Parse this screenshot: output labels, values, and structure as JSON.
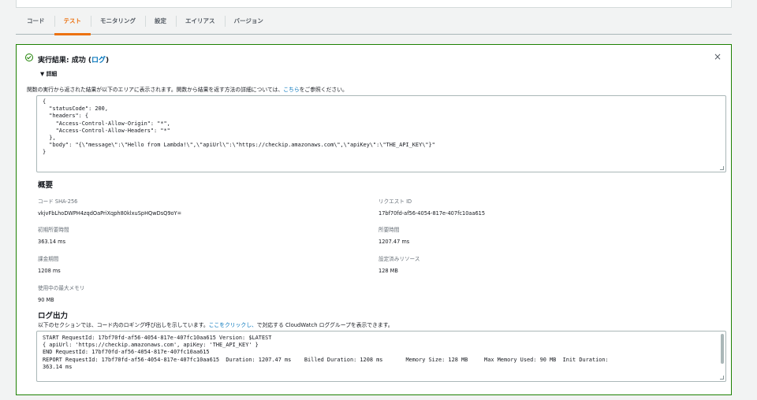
{
  "tabs": [
    "コード",
    "テスト",
    "モニタリング",
    "設定",
    "エイリアス",
    "バージョン"
  ],
  "result": {
    "title_prefix": "実行結果: 成功 (",
    "title_link": "ログ",
    "title_suffix": ")",
    "close": "×",
    "details_label": "▼ 詳細",
    "description_prefix": "関数の実行から返された結果が以下のエリアに表示されます。関数から結果を返す方法の詳細については、",
    "description_link": "こちら",
    "description_suffix": "をご参照ください。",
    "output": "{\n  \"statusCode\": 200,\n  \"headers\": {\n    \"Access-Control-Allow-Origin\": \"*\",\n    \"Access-Control-Allow-Headers\": \"*\"\n  },\n  \"body\": \"{\\\"message\\\":\\\"Hello from Lambda!\\\",\\\"apiUrl\\\":\\\"https://checkip.amazonaws.com\\\",\\\"apiKey\\\":\\\"THE_API_KEY\\\"}\"\n}"
  },
  "summary": {
    "heading": "概要",
    "code_sha_label": "コード SHA-256",
    "code_sha_value": "vkjvFbLhoDWPH4zqdOaPriXqph80klxuSpHQwDsQ9oY=",
    "request_id_label": "リクエスト ID",
    "request_id_value": "17bf70fd-af56-4054-817e-407fc10aa615",
    "init_duration_label": "初期所要時間",
    "init_duration_value": "363.14 ms",
    "duration_label": "所要時間",
    "duration_value": "1207.47 ms",
    "billed_label": "課金期間",
    "billed_value": "1208 ms",
    "resources_label": "設定済みリソース",
    "resources_value": "128 MB",
    "max_memory_label": "使用中の最大メモリ",
    "max_memory_value": "90 MB"
  },
  "log": {
    "heading": "ログ出力",
    "description_prefix": "以下のセクションでは、コード内のロギング呼び出しを示しています。",
    "description_link": "ここをクリックし、",
    "description_suffix": "で対応する CloudWatch ロググループを表示できます。",
    "output": "START RequestId: 17bf70fd-af56-4054-817e-407fc10aa615 Version: $LATEST\n{ apiUrl: 'https://checkip.amazonaws.com', apiKey: 'THE_API_KEY' }\nEND RequestId: 17bf70fd-af56-4054-817e-407fc10aa615\nREPORT RequestId: 17bf70fd-af56-4054-817e-407fc10aa615  Duration: 1207.47 ms    Billed Duration: 1208 ms       Memory Size: 128 MB     Max Memory Used: 90 MB  Init Duration:\n363.14 ms"
  }
}
